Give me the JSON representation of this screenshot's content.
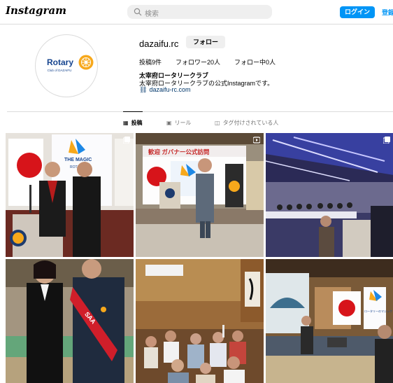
{
  "header": {
    "logo": "Instagram",
    "search_placeholder": "検索",
    "login_label": "ログイン",
    "signup_label": "登録"
  },
  "profile": {
    "avatar_logo_text": "Rotary",
    "avatar_club_text": "Club of DAZAIFU",
    "username": "dazaifu.rc",
    "follow_label": "フォロー",
    "posts": "投稿9件",
    "followers": "フォロワー20人",
    "following": "フォロー中0人",
    "display_name": "太宰府ロータリークラブ",
    "bio": "太宰府ロータリークラブの公式Instagramです。",
    "link": "dazaifu-rc.com"
  },
  "tabs": [
    {
      "label": "投稿",
      "icon": "grid-icon",
      "active": true
    },
    {
      "label": "リール",
      "icon": "reels-icon",
      "active": false
    },
    {
      "label": "タグ付けされている人",
      "icon": "tag-icon",
      "active": false
    }
  ],
  "posts": [
    {
      "kind": "carousel",
      "scene": "two men at podium with Rotary flag",
      "banner_text": "THE MAGIC",
      "banner_text_2": "ROTARY"
    },
    {
      "kind": "video",
      "scene": "man speaking at stage",
      "banner_text": "歓迎 ガバナー公式訪問"
    },
    {
      "kind": "carousel",
      "scene": "banquet hall dinner"
    },
    {
      "kind": "image",
      "scene": "woman and man with sash",
      "sash_text": "SAA"
    },
    {
      "kind": "image",
      "scene": "group toasting"
    },
    {
      "kind": "image",
      "scene": "presentation with screen",
      "banner_text": "ロータリーのマジック"
    }
  ],
  "colors": {
    "accent": "#0095f6",
    "rotary_blue": "#17458f",
    "rotary_gold": "#f7a81b"
  }
}
